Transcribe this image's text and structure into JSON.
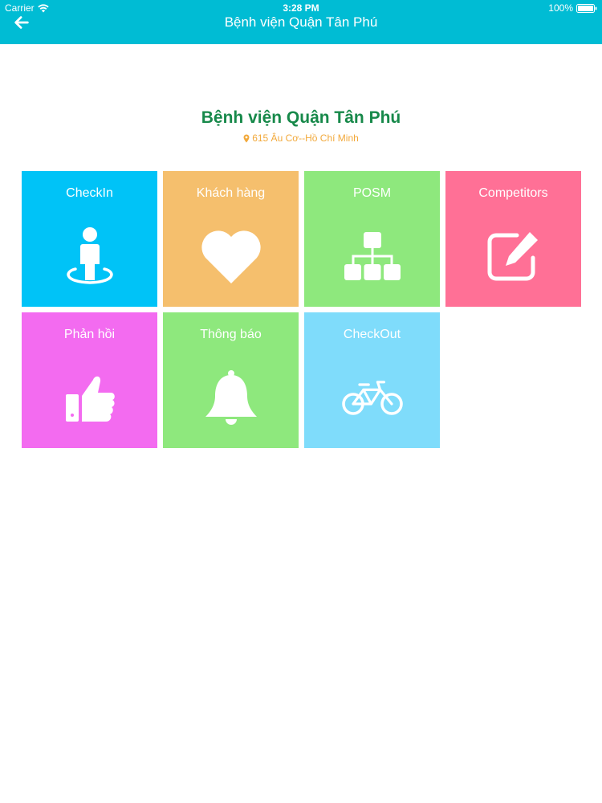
{
  "status_bar": {
    "carrier": "Carrier",
    "time": "3:28 PM",
    "battery": "100%"
  },
  "nav": {
    "title": "Bệnh viện Quận Tân Phú",
    "back_icon": "arrow-left-icon"
  },
  "place": {
    "name": "Bệnh viện Quận Tân Phú",
    "address": "615 Âu Cơ--Hồ Chí Minh",
    "address_icon": "map-pin-icon"
  },
  "colors": {
    "topbar": "#00bcd4",
    "title_green": "#17894a",
    "address_orange": "#f2a93b"
  },
  "tiles": [
    {
      "label": "CheckIn",
      "color": "#00c3f7",
      "icon": "person-checkin-icon"
    },
    {
      "label": "Khách hàng",
      "color": "#f5bf6d",
      "icon": "heart-icon"
    },
    {
      "label": "POSM",
      "color": "#8ee87d",
      "icon": "org-chart-icon"
    },
    {
      "label": "Competitors",
      "color": "#ff7096",
      "icon": "edit-icon"
    },
    {
      "label": "Phản hồi",
      "color": "#f36bf0",
      "icon": "thumbs-up-icon"
    },
    {
      "label": "Thông báo",
      "color": "#8ee87d",
      "icon": "bell-icon"
    },
    {
      "label": "CheckOut",
      "color": "#7fdcfb",
      "icon": "bicycle-icon"
    }
  ]
}
